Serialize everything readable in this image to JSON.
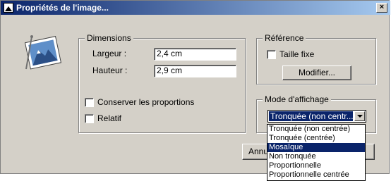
{
  "window": {
    "title": "Propriétés de l'image...",
    "close_label": "×"
  },
  "dimensions": {
    "legend": "Dimensions",
    "width_label": "Largeur :",
    "width_value": "2,4 cm",
    "height_label": "Hauteur :",
    "height_value": "2,9 cm",
    "keep_proportions_label": "Conserver les proportions",
    "relative_label": "Relatif"
  },
  "reference": {
    "legend": "Référence",
    "fixed_size_label": "Taille fixe",
    "modify_label": "Modifier..."
  },
  "display_mode": {
    "legend": "Mode d'affichage",
    "selected_value": "Tronquée (non centr...",
    "options": [
      "Tronquée (non centrée)",
      "Tronquée (centrée)",
      "Mosaïque",
      "Non tronquée",
      "Proportionnelle",
      "Proportionnelle centrée"
    ],
    "highlighted_index": 2
  },
  "footer": {
    "cancel_label": "Annu"
  }
}
